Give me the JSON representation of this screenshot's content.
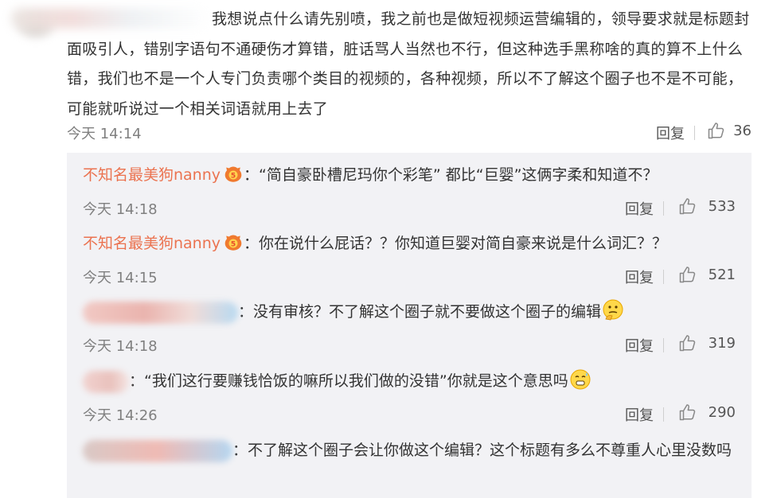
{
  "main_comment": {
    "text": "我想说点什么请先别喷，我之前也是做短视频运营编辑的，领导要求就是标题封面吸引人，错别字语句不通硬伤才算错，脏话骂人当然也不行，但这种选手黑称啥的真的算不上什么错，我们也不是一个人专门负责哪个类目的视频的，各种视频，所以不了解这个圈子也不是不可能，可能就听说过一个相关词语就用上去了",
    "time": "今天 14:14",
    "reply_label": "回复",
    "like_count": "36"
  },
  "replies": [
    {
      "username": "不知名最美狗nanny",
      "text": "：“简自豪卧槽尼玛你个彩笔” 都比“巨婴”这俩字柔和知道不？",
      "time": "今天 14:18",
      "reply_label": "回复",
      "like_count": "533"
    },
    {
      "username": "不知名最美狗nanny",
      "text": "：你在说什么屁话？？你知道巨婴对简自豪来说是什么词汇？？",
      "time": "今天 14:15",
      "reply_label": "回复",
      "like_count": "521"
    },
    {
      "text": "：没有审核？不了解这个圈子就不要做这个圈子的编辑",
      "time": "今天 14:18",
      "reply_label": "回复",
      "like_count": "319"
    },
    {
      "text": "：“我们这行要赚钱恰饭的嘛所以我们做的没错”你就是这个意思吗",
      "time": "今天 14:26",
      "reply_label": "回复",
      "like_count": "290"
    },
    {
      "text": "：不了解这个圈子会让你做这个编辑？这个标题有多么不尊重人心里没数吗"
    }
  ],
  "colors": {
    "username": "#eb7350",
    "reply_box_bg": "#f2f2f5",
    "meta_text": "#808080"
  },
  "icons": {
    "like": "thumbs-up-icon",
    "vip": "vip-badge-icon",
    "emoji_think": "thinking-face-icon",
    "emoji_sweat": "nervous-face-icon"
  }
}
